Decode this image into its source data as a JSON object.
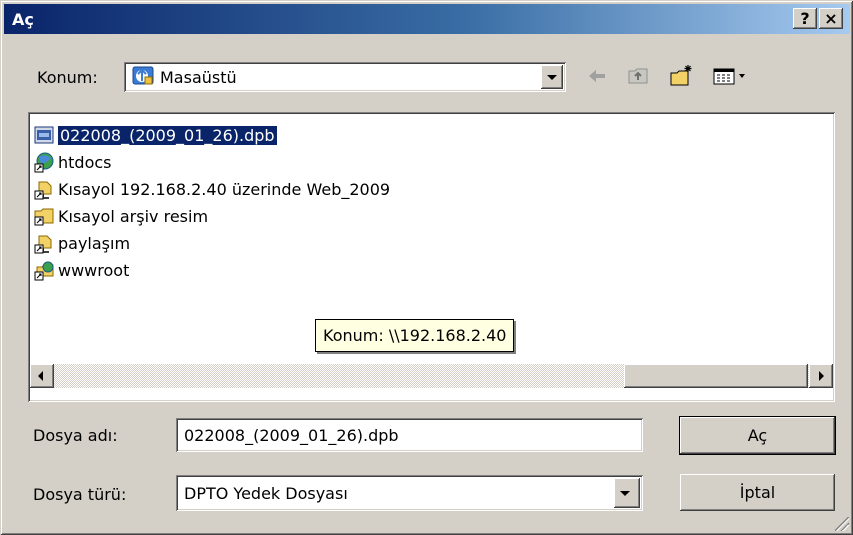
{
  "window": {
    "title": "Aç",
    "help_button": "?",
    "close_button": "×"
  },
  "location": {
    "label": "Konum:",
    "value": "Masaüstü",
    "icon": "desktop-icon"
  },
  "toolbar": {
    "back_icon": "back-arrow-icon",
    "up_folder_icon": "up-folder-icon",
    "new_folder_icon": "new-folder-icon",
    "view_menu_icon": "view-menu-icon"
  },
  "files": [
    {
      "name": "022008_(2009_01_26).dpb",
      "icon": "dpb-file-icon",
      "selected": true
    },
    {
      "name": "htdocs",
      "icon": "network-shortcut-icon",
      "selected": false
    },
    {
      "name": "Kısayol 192.168.2.40 üzerinde Web_2009",
      "icon": "network-folder-shortcut-icon",
      "selected": false
    },
    {
      "name": "Kısayol arşiv resim",
      "icon": "folder-shortcut-icon",
      "selected": false
    },
    {
      "name": "paylaşım",
      "icon": "network-folder-shortcut-icon",
      "selected": false
    },
    {
      "name": "wwwroot",
      "icon": "network-share-shortcut-icon",
      "selected": false
    }
  ],
  "tooltip": {
    "text": "Konum: \\\\192.168.2.40"
  },
  "filename": {
    "label": "Dosya adı:",
    "value": "022008_(2009_01_26).dpb"
  },
  "filetype": {
    "label": "Dosya türü:",
    "value": "DPTO Yedek Dosyası"
  },
  "buttons": {
    "open": "Aç",
    "cancel": "İptal"
  },
  "colors": {
    "title_start": "#0a246a",
    "title_end": "#a6caf0",
    "selection": "#0a246a",
    "tooltip_bg": "#ffffe1"
  }
}
